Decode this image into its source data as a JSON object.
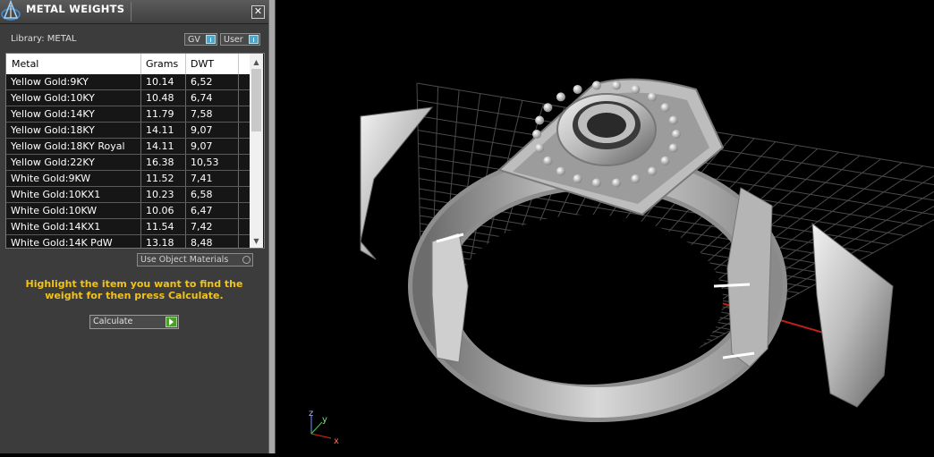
{
  "panel": {
    "title": "METAL WEIGHTS",
    "close_label": "✕",
    "library_label": "Library: METAL",
    "toggles": {
      "gv": "GV",
      "user": "User"
    },
    "columns": {
      "metal": "Metal",
      "grams": "Grams",
      "dwt": "DWT"
    },
    "rows": [
      {
        "metal": "Yellow Gold:9KY",
        "grams": "10.14",
        "dwt": "6,52"
      },
      {
        "metal": "Yellow Gold:10KY",
        "grams": "10.48",
        "dwt": "6,74"
      },
      {
        "metal": "Yellow Gold:14KY",
        "grams": "11.79",
        "dwt": "7,58"
      },
      {
        "metal": "Yellow Gold:18KY",
        "grams": "14.11",
        "dwt": "9,07"
      },
      {
        "metal": "Yellow Gold:18KY Royal",
        "grams": "14.11",
        "dwt": "9,07"
      },
      {
        "metal": "Yellow Gold:22KY",
        "grams": "16.38",
        "dwt": "10,53"
      },
      {
        "metal": "White Gold:9KW",
        "grams": "11.52",
        "dwt": "7,41"
      },
      {
        "metal": "White Gold:10KX1",
        "grams": "10.23",
        "dwt": "6,58"
      },
      {
        "metal": "White Gold:10KW",
        "grams": "10.06",
        "dwt": "6,47"
      },
      {
        "metal": "White Gold:14KX1",
        "grams": "11.54",
        "dwt": "7,42"
      },
      {
        "metal": "White Gold:14K PdW",
        "grams": "13.18",
        "dwt": "8,48"
      }
    ],
    "use_object_label": "Use Object Materials",
    "hint": "Highlight the item you want to find the weight for then press Calculate.",
    "calculate_label": "Calculate"
  },
  "viewport": {
    "axis_labels": {
      "x": "x",
      "y": "y",
      "z": "z"
    }
  },
  "colors": {
    "panel_bg": "#3c3c3c",
    "hint": "#f2c31a",
    "toggle_accent": "#4fa6c9",
    "calculate_accent": "#4aa02a",
    "grid_line": "#4a4a4a",
    "x_axis": "#c0201c"
  }
}
